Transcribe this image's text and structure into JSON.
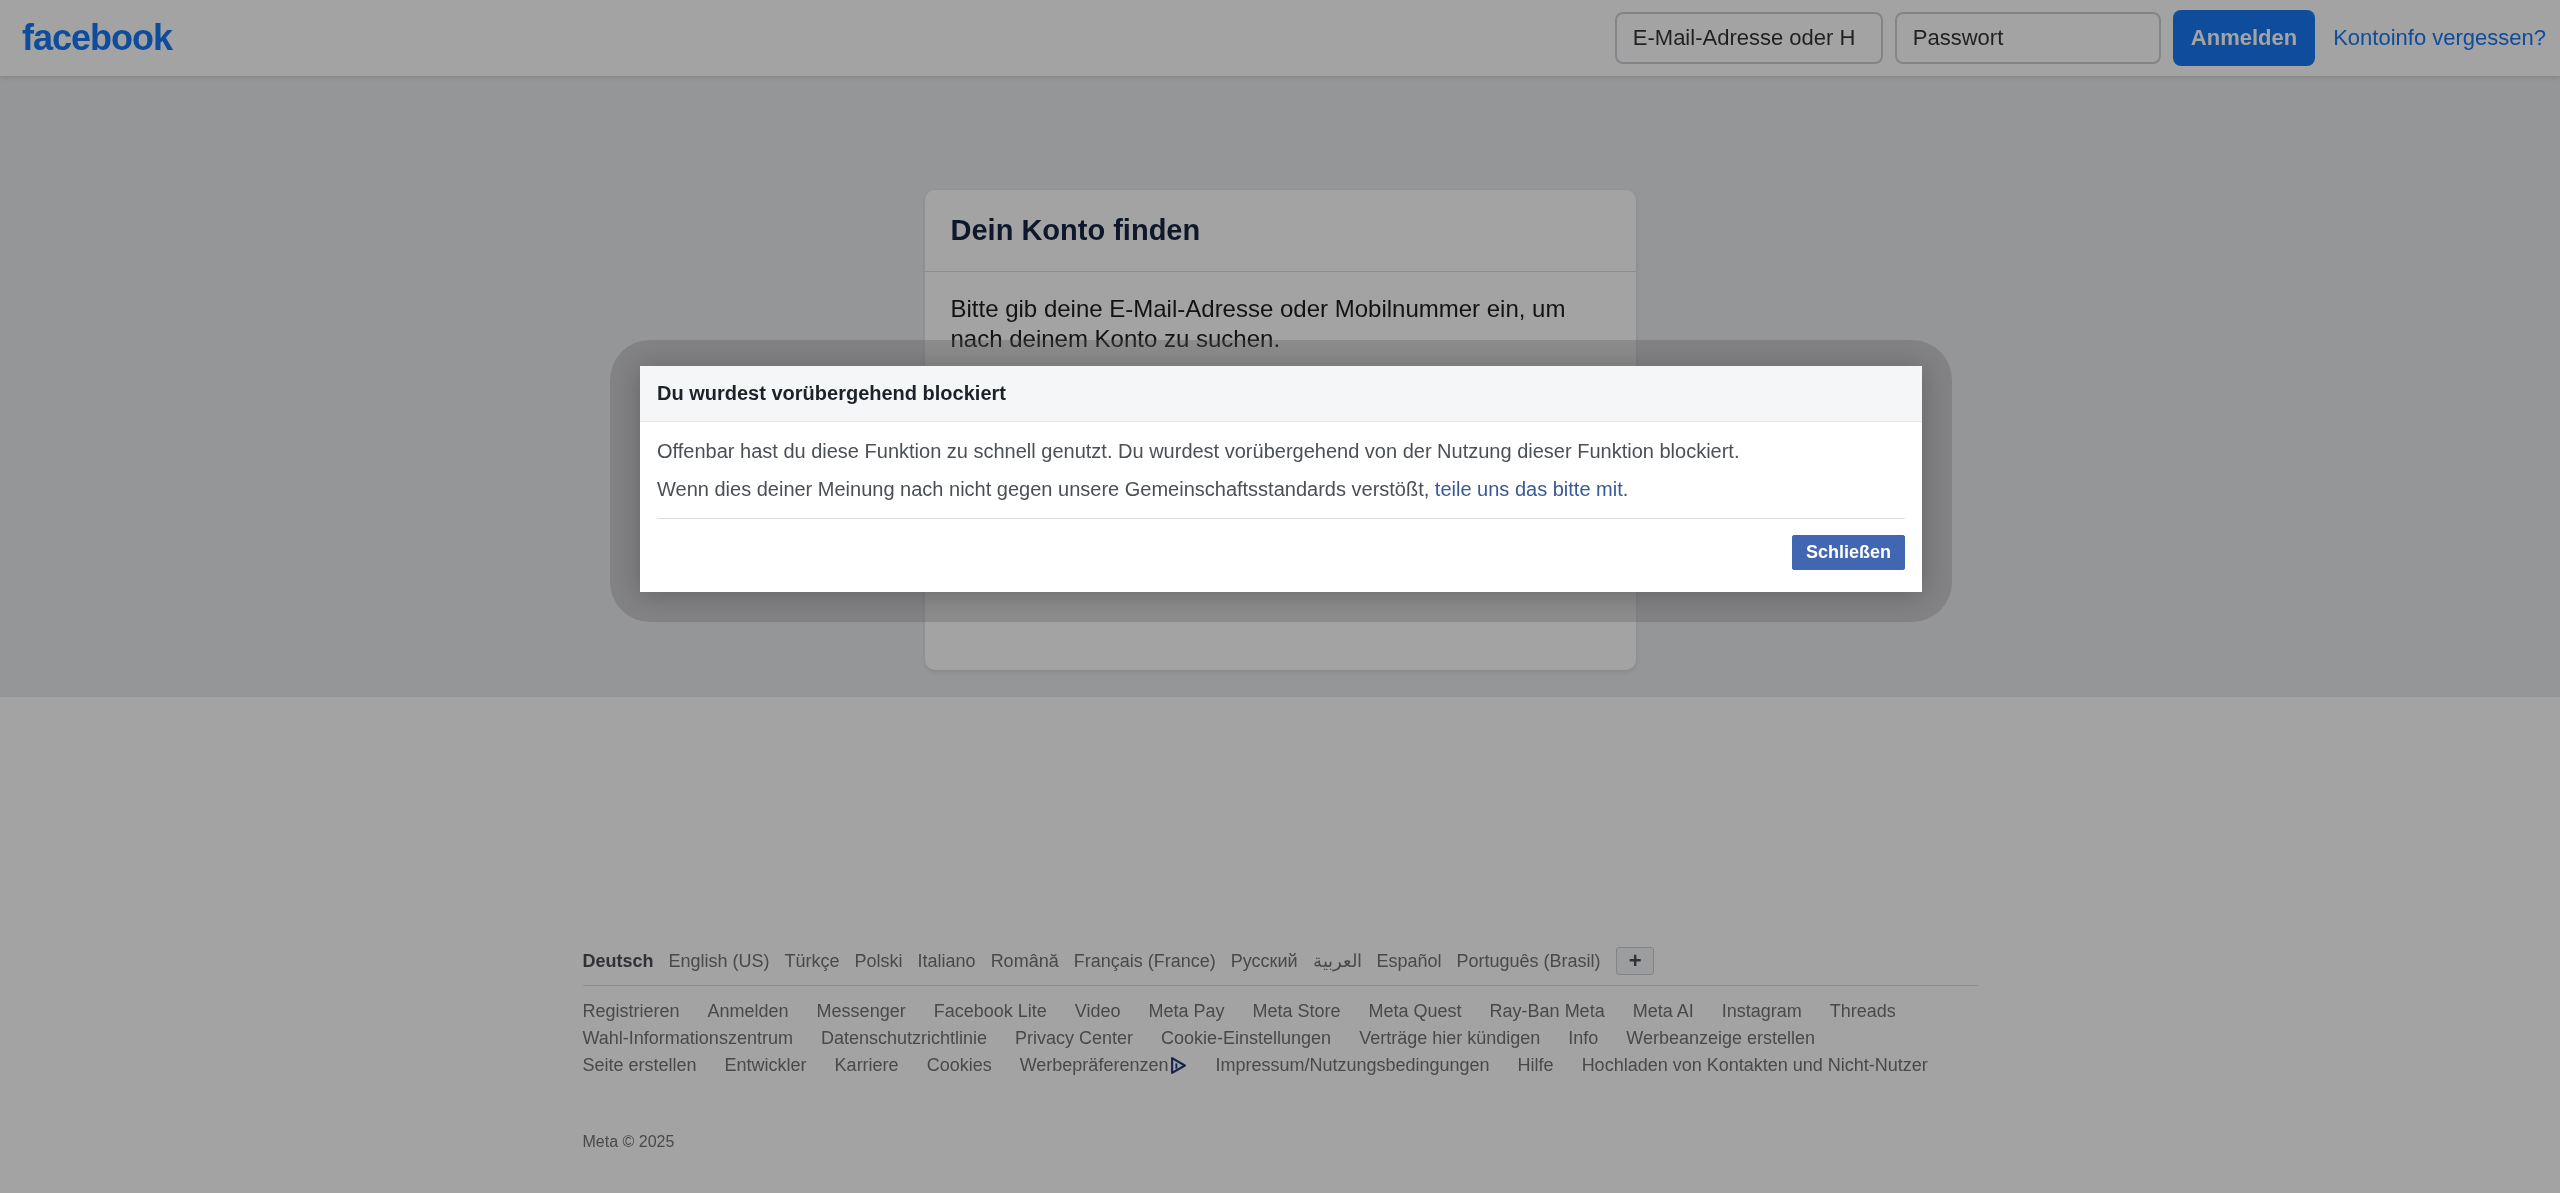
{
  "header": {
    "logo": "facebook",
    "email_field": {
      "placeholder": "E-Mail-Adresse oder H"
    },
    "password_field": {
      "placeholder": "Passwort"
    },
    "login_button": "Anmelden",
    "forgot_link": "Kontoinfo vergessen?"
  },
  "find_account_card": {
    "title": "Dein Konto finden",
    "text": "Bitte gib deine E-Mail-Adresse oder Mobilnummer ein, um nach deinem Konto zu suchen."
  },
  "dialog": {
    "title": "Du wurdest vorübergehend blockiert",
    "message": "Offenbar hast du diese Funktion zu schnell genutzt. Du wurdest vorübergehend von der Nutzung dieser Funktion blockiert.",
    "appeal_text": "Wenn dies deiner Meinung nach nicht gegen unsere Gemeinschaftsstandards verstößt,",
    "appeal_link": "teile uns das bitte mit",
    "appeal_end": ".",
    "close_button": "Schließen"
  },
  "footer": {
    "languages": [
      {
        "label": "Deutsch",
        "selected": true
      },
      {
        "label": "English (US)",
        "selected": false
      },
      {
        "label": "Türkçe",
        "selected": false
      },
      {
        "label": "Polski",
        "selected": false
      },
      {
        "label": "Italiano",
        "selected": false
      },
      {
        "label": "Română",
        "selected": false
      },
      {
        "label": "Français (France)",
        "selected": false
      },
      {
        "label": "Русский",
        "selected": false
      },
      {
        "label": "العربية",
        "selected": false
      },
      {
        "label": "Español",
        "selected": false
      },
      {
        "label": "Português (Brasil)",
        "selected": false
      }
    ],
    "more_languages_button": "+",
    "link_rows": [
      [
        {
          "label": "Registrieren",
          "kind": "plain"
        },
        {
          "label": "Anmelden",
          "kind": "plain"
        },
        {
          "label": "Messenger",
          "kind": "plain"
        },
        {
          "label": "Facebook Lite",
          "kind": "plain"
        },
        {
          "label": "Video",
          "kind": "plain"
        },
        {
          "label": "Meta Pay",
          "kind": "plain"
        },
        {
          "label": "Meta Store",
          "kind": "plain"
        },
        {
          "label": "Meta Quest",
          "kind": "plain"
        },
        {
          "label": "Ray-Ban Meta",
          "kind": "plain"
        },
        {
          "label": "Meta AI",
          "kind": "plain"
        },
        {
          "label": "Instagram",
          "kind": "plain"
        },
        {
          "label": "Threads",
          "kind": "plain"
        }
      ],
      [
        {
          "label": "Wahl-Informationszentrum",
          "kind": "plain"
        },
        {
          "label": "Datenschutzrichtlinie",
          "kind": "plain"
        },
        {
          "label": "Privacy Center",
          "kind": "plain"
        },
        {
          "label": "Cookie-Einstellungen",
          "kind": "plain"
        },
        {
          "label": "Verträge hier kündigen",
          "kind": "plain"
        },
        {
          "label": "Info",
          "kind": "plain"
        },
        {
          "label": "Werbeanzeige erstellen",
          "kind": "plain"
        }
      ],
      [
        {
          "label": "Seite erstellen",
          "kind": "plain"
        },
        {
          "label": "Entwickler",
          "kind": "plain"
        },
        {
          "label": "Karriere",
          "kind": "plain"
        },
        {
          "label": "Cookies",
          "kind": "plain"
        },
        {
          "label": "Werbepräferenzen",
          "kind": "ad_choices"
        },
        {
          "label": "Impressum/Nutzungsbedingungen",
          "kind": "plain"
        },
        {
          "label": "Hilfe",
          "kind": "plain"
        },
        {
          "label": "Hochladen von Kontakten und Nicht-Nutzer",
          "kind": "plain"
        }
      ]
    ],
    "copyright": "Meta © 2025"
  }
}
